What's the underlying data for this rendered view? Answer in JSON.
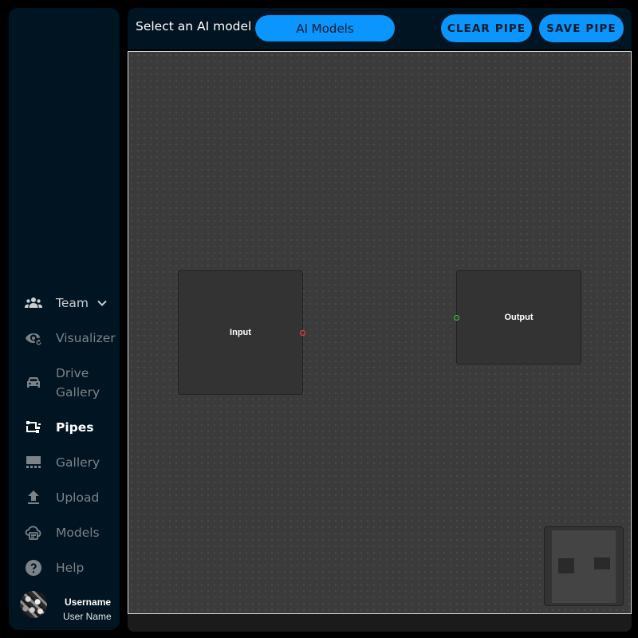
{
  "sidebar": {
    "items": [
      {
        "label": "Team",
        "icon": "group-icon",
        "state": "light",
        "has_chevron": true
      },
      {
        "label": "Visualizer",
        "icon": "eye-refresh-icon",
        "state": "muted"
      },
      {
        "label": "Drive",
        "label2": "Gallery",
        "icon": "car-icon",
        "state": "muted"
      },
      {
        "label": "Pipes",
        "icon": "pipes-icon",
        "state": "active"
      },
      {
        "label": "Gallery",
        "icon": "gallery-icon",
        "state": "muted"
      },
      {
        "label": "Upload",
        "icon": "upload-icon",
        "state": "muted"
      },
      {
        "label": "Models",
        "icon": "model-icon",
        "state": "muted"
      },
      {
        "label": "Help",
        "icon": "help-icon",
        "state": "muted"
      }
    ],
    "user": {
      "name": "Username",
      "role": "User Name"
    }
  },
  "topbar": {
    "select_label": "Select an AI model",
    "models_button": "AI Models",
    "clear_button": "CLEAR PIPE",
    "save_button": "SAVE PIPE"
  },
  "canvas": {
    "nodes": {
      "input": {
        "label": "Input"
      },
      "output": {
        "label": "Output"
      }
    }
  },
  "colors": {
    "accent": "#0a95ff",
    "sidebar_bg": "#011421",
    "canvas_bg": "#3b3b3b",
    "source_handle": "#ff3b3b",
    "target_handle": "#37c936"
  }
}
